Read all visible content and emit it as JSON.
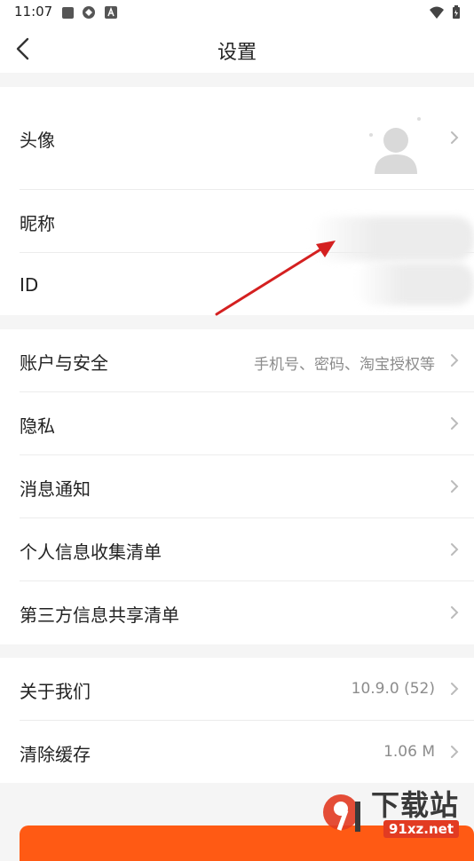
{
  "status_bar": {
    "time": "11:07"
  },
  "header": {
    "title": "设置"
  },
  "profile": {
    "avatar_label": "头像",
    "nickname_label": "昵称",
    "id_label": "ID"
  },
  "settings": {
    "items": [
      {
        "label": "账户与安全",
        "value": "手机号、密码、淘宝授权等"
      },
      {
        "label": "隐私",
        "value": ""
      },
      {
        "label": "消息通知",
        "value": ""
      },
      {
        "label": "个人信息收集清单",
        "value": ""
      },
      {
        "label": "第三方信息共享清单",
        "value": ""
      }
    ]
  },
  "about": {
    "items": [
      {
        "label": "关于我们",
        "value": "10.9.0 (52)"
      },
      {
        "label": "清除缓存",
        "value": "1.06 M"
      }
    ]
  },
  "watermark": {
    "text": "下载站",
    "domain": "91xz.net"
  },
  "colors": {
    "accent": "#ff5a14",
    "annotation_arrow": "#d42020",
    "secondary_text": "#8c8c8c"
  }
}
